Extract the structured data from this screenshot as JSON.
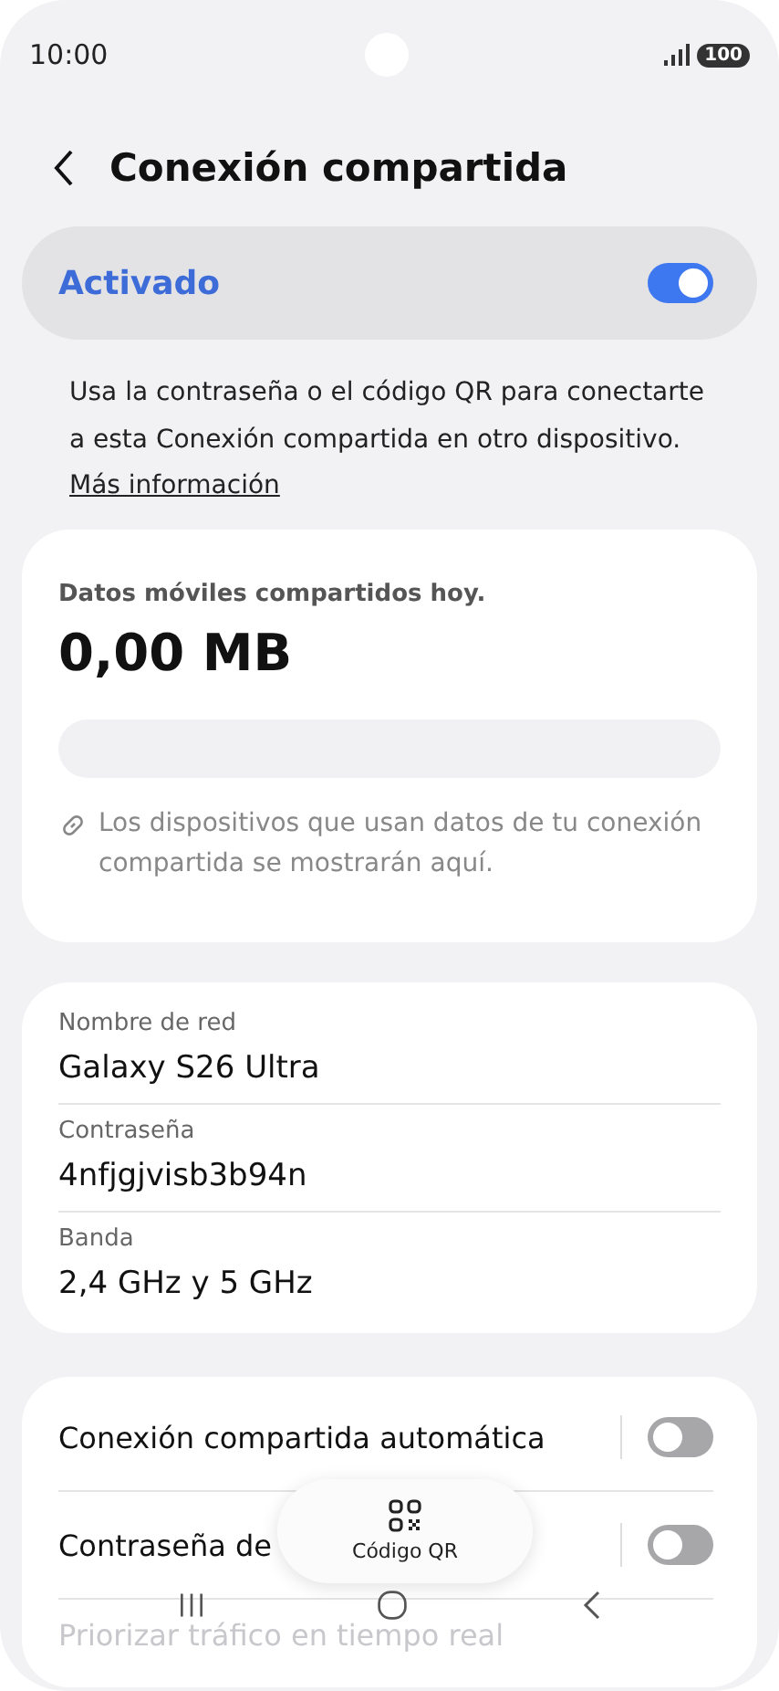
{
  "status_bar": {
    "time": "10:00",
    "battery": "100"
  },
  "header": {
    "title": "Conexión compartida"
  },
  "master_switch": {
    "label": "Activado",
    "on": true
  },
  "info": {
    "text": "Usa la contraseña o el código QR para conectarte a esta Conexión compartida en otro dispositivo.",
    "link": "Más información"
  },
  "usage": {
    "label": "Datos móviles compartidos hoy.",
    "amount": "0,00 MB",
    "hint": "Los dispositivos que usan datos de tu conexión compartida se mostrarán aquí."
  },
  "network": [
    {
      "label": "Nombre de red",
      "value": "Galaxy S26 Ultra"
    },
    {
      "label": "Contraseña",
      "value": "4nfjgjvisb3b94n"
    },
    {
      "label": "Banda",
      "value": "2,4 GHz y 5 GHz"
    }
  ],
  "toggles": [
    {
      "label": "Conexión compartida automática",
      "on": false
    },
    {
      "label": "Contraseña de",
      "on": false
    },
    {
      "label": "Priorizar tráfico en tiempo real"
    }
  ],
  "qr_button": {
    "label": "Código QR"
  }
}
